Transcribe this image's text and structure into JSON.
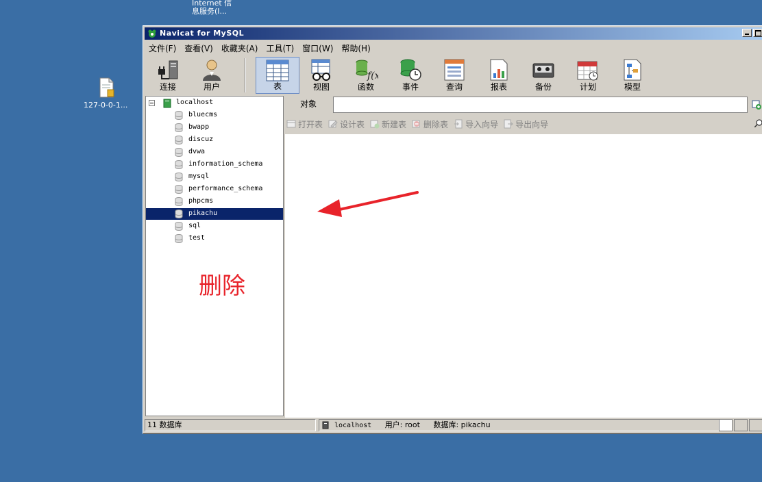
{
  "desktop": {
    "top_icon_label_line1": "Internet 信",
    "top_icon_label_line2": "息服务(I...",
    "file_icon_label": "127-0-0-1..."
  },
  "window": {
    "title": "Navicat for MySQL"
  },
  "menu": [
    {
      "label": "文件(F)"
    },
    {
      "label": "查看(V)"
    },
    {
      "label": "收藏夹(A)"
    },
    {
      "label": "工具(T)"
    },
    {
      "label": "窗口(W)"
    },
    {
      "label": "帮助(H)"
    }
  ],
  "toolbar": {
    "connect": "连接",
    "user": "用户",
    "table": "表",
    "view": "视图",
    "function": "函数",
    "event": "事件",
    "query": "查询",
    "report": "报表",
    "backup": "备份",
    "schedule": "计划",
    "model": "模型"
  },
  "tree": {
    "root": "localhost",
    "databases": [
      {
        "name": "bluecms"
      },
      {
        "name": "bwapp"
      },
      {
        "name": "discuz"
      },
      {
        "name": "dvwa"
      },
      {
        "name": "information_schema"
      },
      {
        "name": "mysql"
      },
      {
        "name": "performance_schema"
      },
      {
        "name": "phpcms"
      },
      {
        "name": "pikachu"
      },
      {
        "name": "sql"
      },
      {
        "name": "test"
      }
    ],
    "selected": "pikachu"
  },
  "annotation": {
    "text": "删除",
    "color": "#e8232a"
  },
  "object_tab": {
    "label": "对象"
  },
  "actions": {
    "open_table": "打开表",
    "design_table": "设计表",
    "new_table": "新建表",
    "delete_table": "删除表",
    "import_wizard": "导入向导",
    "export_wizard": "导出向导"
  },
  "status": {
    "db_count": "11 数据库",
    "server": "localhost",
    "user": "用户: root",
    "database": "数据库: pikachu"
  },
  "colors": {
    "desktop": "#3a6ea5",
    "title_gradient_start": "#0a246a",
    "selection": "#0a246a"
  }
}
